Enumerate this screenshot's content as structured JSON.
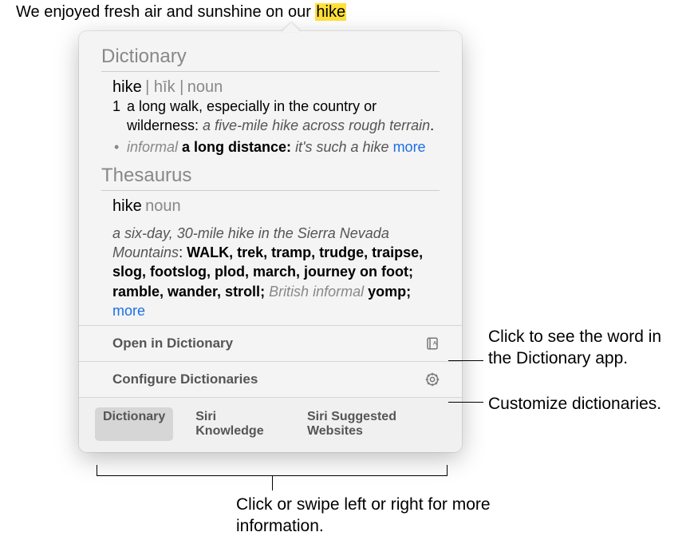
{
  "sentence": {
    "before": "We enjoyed fresh air and sunshine on our ",
    "highlight": "hike"
  },
  "dictionary": {
    "title": "Dictionary",
    "word": "hike",
    "pronunciation": "| hīk |",
    "pos": "noun",
    "sense_num": "1",
    "definition": "a long walk, especially in the country or wilderness: ",
    "example": "a five-mile hike across rough terrain",
    "period": ".",
    "sub_label": "informal",
    "sub_def": " a long distance: ",
    "sub_example": "it's such a hike ",
    "more": "more"
  },
  "thesaurus": {
    "title": "Thesaurus",
    "word": "hike",
    "pos": "noun",
    "example": "a six-day, 30-mile hike in the Sierra Nevada Mountains",
    "colon": ": ",
    "cap_syn": "WALK",
    "syns": ", trek, tramp, trudge, traipse, slog, footslog, plod, march, journey on foot; ramble, wander, stroll; ",
    "brit_label": "British informal",
    "brit_syn": " yomp; ",
    "more": "more"
  },
  "actions": {
    "open": "Open in Dictionary",
    "configure": "Configure Dictionaries"
  },
  "tabs": {
    "dictionary": "Dictionary",
    "siri_knowledge": "Siri Knowledge",
    "siri_websites": "Siri Suggested Websites"
  },
  "callouts": {
    "open": "Click to see the word in the Dictionary app.",
    "configure": "Customize dictionaries.",
    "tabs": "Click or swipe left or right for more information."
  }
}
